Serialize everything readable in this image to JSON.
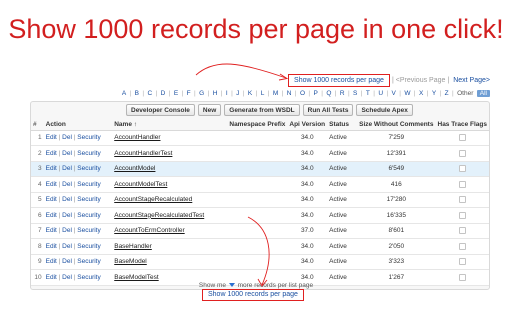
{
  "headline": "Show 1000 records per page in one click!",
  "pager": {
    "show_1000_label": "Show 1000 records per page",
    "separator": "|",
    "previous_label": "<Previous Page",
    "next_label": "Next Page>"
  },
  "alphabet": {
    "letters": [
      "A",
      "B",
      "C",
      "D",
      "E",
      "F",
      "G",
      "H",
      "I",
      "J",
      "K",
      "L",
      "M",
      "N",
      "O",
      "P",
      "Q",
      "R",
      "S",
      "T",
      "U",
      "V",
      "W",
      "X",
      "Y",
      "Z"
    ],
    "other_label": "Other",
    "all_label": "All"
  },
  "buttons": {
    "developer_console": "Developer Console",
    "new": "New",
    "generate_wsdl": "Generate from WSDL",
    "run_all_tests": "Run All Tests",
    "schedule_apex": "Schedule Apex"
  },
  "table": {
    "headers": {
      "num": "#",
      "action": "Action",
      "name": "Name ↑",
      "namespace": "Namespace Prefix",
      "api": "Api Version",
      "status": "Status",
      "size": "Size Without Comments",
      "trace": "Has Trace Flags"
    },
    "action_labels": {
      "edit": "Edit",
      "del": "Del",
      "security": "Security",
      "pipe": "|"
    },
    "rows": [
      {
        "num": "1",
        "name": "AccountHandler",
        "api": "34.0",
        "status": "Active",
        "size": "7'259"
      },
      {
        "num": "2",
        "name": "AccountHandlerTest",
        "api": "34.0",
        "status": "Active",
        "size": "12'391"
      },
      {
        "num": "3",
        "name": "AccountModel",
        "api": "34.0",
        "status": "Active",
        "size": "6'549"
      },
      {
        "num": "4",
        "name": "AccountModelTest",
        "api": "34.0",
        "status": "Active",
        "size": "416"
      },
      {
        "num": "5",
        "name": "AccountStageRecalculated",
        "api": "34.0",
        "status": "Active",
        "size": "17'280"
      },
      {
        "num": "6",
        "name": "AccountStageRecalculatedTest",
        "api": "34.0",
        "status": "Active",
        "size": "16'335"
      },
      {
        "num": "7",
        "name": "AccountToErmController",
        "api": "37.0",
        "status": "Active",
        "size": "8'601"
      },
      {
        "num": "8",
        "name": "BaseHandler",
        "api": "34.0",
        "status": "Active",
        "size": "2'050"
      },
      {
        "num": "9",
        "name": "BaseModel",
        "api": "34.0",
        "status": "Active",
        "size": "3'323"
      },
      {
        "num": "10",
        "name": "BaseModelTest",
        "api": "34.0",
        "status": "Active",
        "size": "1'267"
      }
    ]
  },
  "bottom": {
    "more_prefix": "Show me",
    "more_suffix": "more records per list page",
    "show_1000_label": "Show 1000 records per page"
  },
  "colors": {
    "headline": "#d21f1f",
    "highlight_border": "#e02020",
    "link": "#1a4fa0",
    "selected_row": "#e3f1fb"
  }
}
